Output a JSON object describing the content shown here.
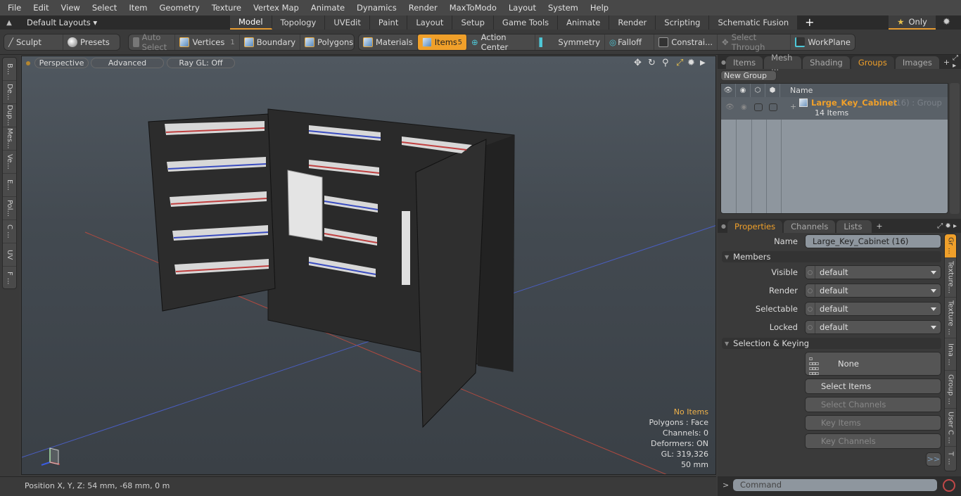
{
  "menubar": [
    "File",
    "Edit",
    "View",
    "Select",
    "Item",
    "Geometry",
    "Texture",
    "Vertex Map",
    "Animate",
    "Dynamics",
    "Render",
    "MaxToModo",
    "Layout",
    "System",
    "Help"
  ],
  "layoutbar": {
    "layouts_label": "Default Layouts ▾",
    "tabs": [
      "Model",
      "Topology",
      "UVEdit",
      "Paint",
      "Layout",
      "Setup",
      "Game Tools",
      "Animate",
      "Render",
      "Scripting",
      "Schematic Fusion"
    ],
    "active_tab": "Model",
    "only_label": "Only"
  },
  "toolbar": {
    "sculpt": "Sculpt",
    "presets": "Presets",
    "auto_select": "Auto Select",
    "vertices": "Vertices",
    "vertices_count": "1",
    "boundary": "Boundary",
    "polygons": "Polygons",
    "materials": "Materials",
    "items": "Items",
    "items_count": "5",
    "action_center": "Action Center",
    "symmetry": "Symmetry",
    "falloff": "Falloff",
    "constraints": "Constrai...",
    "select_through": "Select Through",
    "workplane": "WorkPlane"
  },
  "left_strip": [
    "B...",
    "De...",
    "Dup...",
    "Mes...",
    "Ve...",
    "E...",
    "Pol...",
    "C ...",
    "UV",
    "F ..."
  ],
  "viewport": {
    "perspective": "Perspective",
    "advanced": "Advanced",
    "raygl": "Ray GL: Off",
    "info": {
      "selection": "No Items",
      "polygons": "Polygons : Face",
      "channels": "Channels: 0",
      "deformers": "Deformers: ON",
      "gl": "GL: 319,326",
      "scale": "50 mm"
    }
  },
  "groups_panel": {
    "tabs": [
      "Items",
      "Mesh ...",
      "Shading",
      "Groups",
      "Images"
    ],
    "active_tab": "Groups",
    "new_group": "New Group",
    "name_header": "Name",
    "group": {
      "name": "Large_Key_Cabinet",
      "count": "(16)",
      "type": ": Group",
      "items": "14 Items"
    }
  },
  "properties_panel": {
    "tabs": [
      "Properties",
      "Channels",
      "Lists"
    ],
    "active_tab": "Properties",
    "name_label": "Name",
    "name_value": "Large_Key_Cabinet (16)",
    "members_section": "Members",
    "fields": [
      {
        "label": "Visible",
        "value": "default"
      },
      {
        "label": "Render",
        "value": "default"
      },
      {
        "label": "Selectable",
        "value": "default"
      },
      {
        "label": "Locked",
        "value": "default"
      }
    ],
    "selection_section": "Selection & Keying",
    "none_label": "None",
    "select_items": "Select Items",
    "select_channels": "Select Channels",
    "key_items": "Key Items",
    "key_channels": "Key Channels",
    "more": ">>",
    "side_tabs": [
      "Gr ...",
      "Texture...",
      "Texture ...",
      "Ima ...",
      "Group ...",
      "User C ...",
      "T ..."
    ]
  },
  "statusbar": {
    "position": "Position X, Y, Z:   54 mm, -68 mm, 0 m"
  },
  "command": {
    "prompt": ">",
    "placeholder": "Command"
  },
  "colors": {
    "accent": "#f0a02a",
    "group_name": "#f0a02a"
  }
}
